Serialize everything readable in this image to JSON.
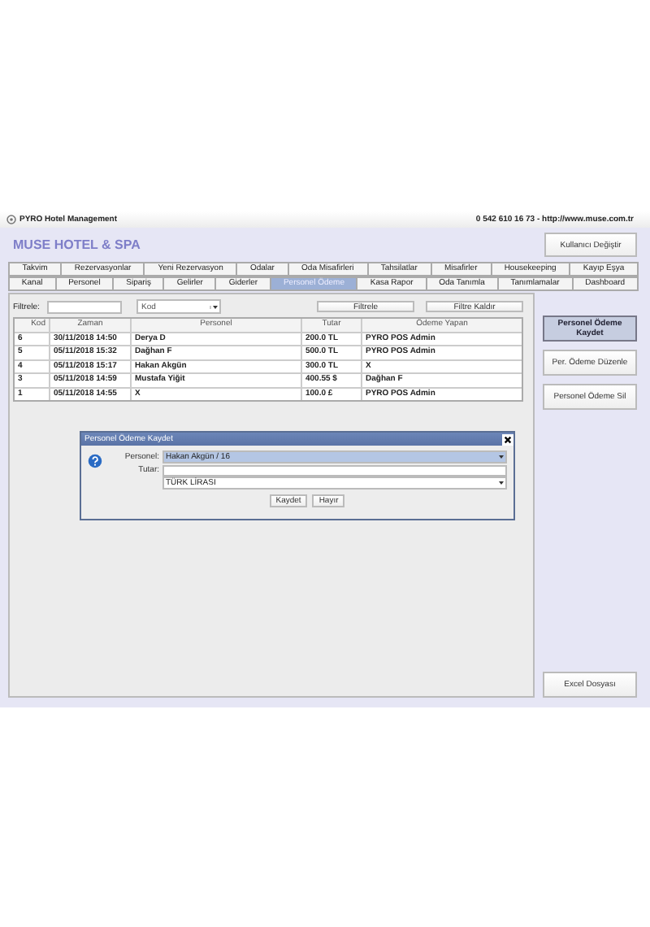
{
  "window": {
    "title": "PYRO Hotel Management",
    "contact": "0 542 610 16 73  -  http://www.muse.com.tr"
  },
  "header": {
    "brand": "MUSE HOTEL & SPA",
    "user_button": "Kullanıcı Değiştir"
  },
  "tabs": [
    [
      {
        "label": "Takvim",
        "selected": false
      },
      {
        "label": "Rezervasyonlar",
        "selected": false
      },
      {
        "label": "Yeni Rezervasyon",
        "selected": false
      },
      {
        "label": "Odalar",
        "selected": false
      },
      {
        "label": "Oda Misafirleri",
        "selected": false
      },
      {
        "label": "Tahsilatlar",
        "selected": false
      },
      {
        "label": "Misafirler",
        "selected": false
      },
      {
        "label": "Housekeeping",
        "selected": false
      },
      {
        "label": "Kayıp Eşya",
        "selected": false
      }
    ],
    [
      {
        "label": "Kanal",
        "selected": false
      },
      {
        "label": "Personel",
        "selected": false
      },
      {
        "label": "Sipariş",
        "selected": false
      },
      {
        "label": "Gelirler",
        "selected": false
      },
      {
        "label": "Giderler",
        "selected": false
      },
      {
        "label": "Personel Ödeme",
        "selected": true
      },
      {
        "label": "Kasa Rapor",
        "selected": false
      },
      {
        "label": "Oda Tanımla",
        "selected": false
      },
      {
        "label": "Tanımlamalar",
        "selected": false
      },
      {
        "label": "Dashboard",
        "selected": false
      }
    ]
  ],
  "filter": {
    "label": "Filtrele:",
    "field": "Kod",
    "buttons": [
      "Filtrele",
      "Filtre Kaldır"
    ]
  },
  "table": {
    "columns": [
      "Kod",
      "Zaman",
      "Personel",
      "Tutar",
      "Ödeme Yapan"
    ],
    "rows": [
      [
        "6",
        "30/11/2018 14:50",
        "Derya D",
        "200.0 TL",
        "PYRO POS Admin"
      ],
      [
        "5",
        "05/11/2018 15:32",
        "Dağhan F",
        "500.0 TL",
        "PYRO POS Admin"
      ],
      [
        "4",
        "05/11/2018 15:17",
        "Hakan Akgün",
        "300.0 TL",
        "X"
      ],
      [
        "3",
        "05/11/2018 14:59",
        "Mustafa Yiğit",
        "400.55 $",
        "Dağhan F"
      ],
      [
        "1",
        "05/11/2018 14:55",
        "X",
        "100.0 £",
        "PYRO POS Admin"
      ]
    ]
  },
  "actions": [
    {
      "label": "Personel Ödeme Kaydet",
      "selected": true
    },
    {
      "label": "Per. Ödeme Düzenle",
      "selected": false
    },
    {
      "label": "Personel Ödeme Sil",
      "selected": false
    }
  ],
  "export_button": "Excel Dosyası",
  "dialog": {
    "title": "Personel Ödeme Kaydet",
    "fields": [
      {
        "kind": "select",
        "label": "Personel:",
        "value": "Hakan Akgün / 16",
        "focused": true
      },
      {
        "kind": "input",
        "label": "Tutar:"
      },
      {
        "kind": "select",
        "value": "TÜRK LİRASI",
        "focused": false
      }
    ],
    "buttons": [
      "Kaydet",
      "Hayır"
    ]
  }
}
